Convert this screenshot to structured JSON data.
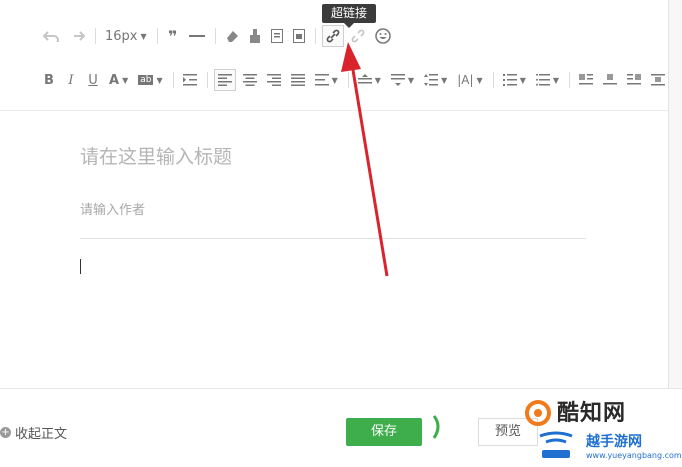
{
  "toolbar": {
    "font_size_label": "16px",
    "tooltip_label": "超链接"
  },
  "editor": {
    "title_placeholder": "请在这里输入标题",
    "author_placeholder": "请输入作者"
  },
  "footer": {
    "collapse_label": "收起正文",
    "save_label": "保存",
    "preview_label": "预览"
  },
  "watermark": {
    "text_main": "酷知网",
    "text_sub": "越手游网",
    "url": "www.yueyangbang.com"
  },
  "colors": {
    "save_green": "#3dae4b",
    "arrow_red": "#d9232d",
    "tooltip_bg": "#3b3b3b"
  }
}
